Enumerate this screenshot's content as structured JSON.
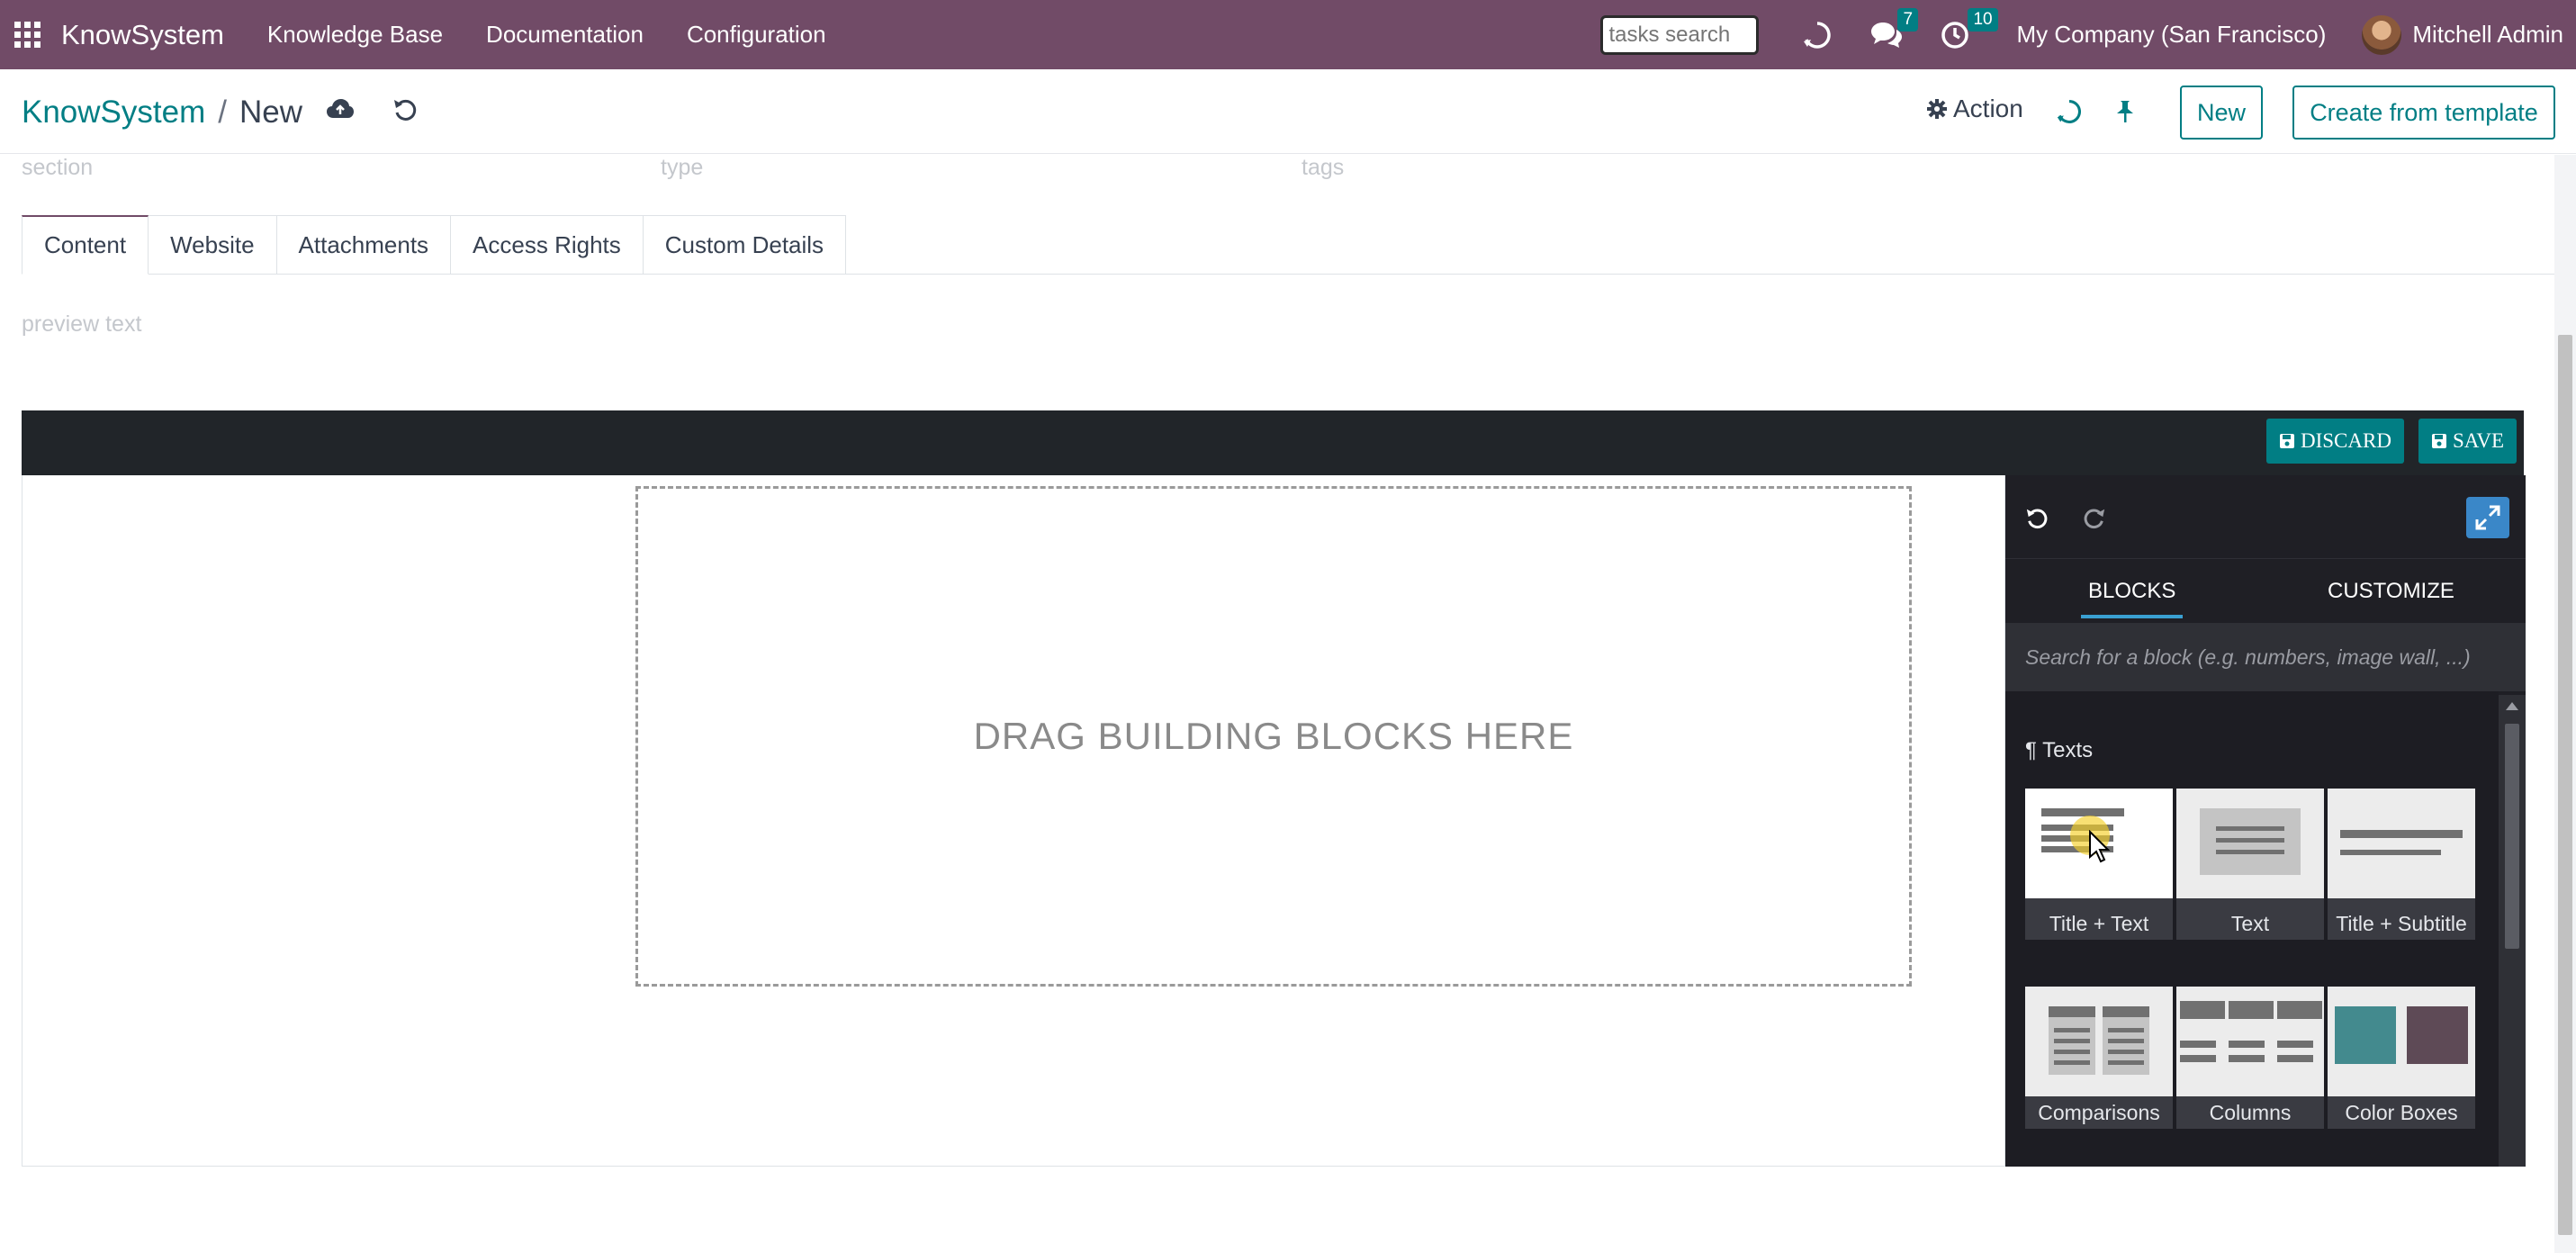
{
  "navbar": {
    "brand": "KnowSystem",
    "menu": [
      "Knowledge Base",
      "Documentation",
      "Configuration"
    ],
    "search_placeholder": "tasks search",
    "messages_count": "7",
    "activities_count": "10",
    "company": "My Company (San Francisco)",
    "user": "Mitchell Admin",
    "bar_color": "#714B67"
  },
  "control_panel": {
    "breadcrumb_root": "KnowSystem",
    "breadcrumb_current": "New",
    "action_label": "Action",
    "new_label": "New",
    "create_template_label": "Create from template"
  },
  "form": {
    "section_placeholder": "section",
    "type_placeholder": "type",
    "tags_placeholder": "tags",
    "tabs": [
      "Content",
      "Website",
      "Attachments",
      "Access Rights",
      "Custom Details"
    ],
    "active_tab": "Content",
    "preview_placeholder": "preview text"
  },
  "editor": {
    "discard_label": "DISCARD",
    "save_label": "SAVE",
    "dropzone_text": "DRAG BUILDING BLOCKS HERE",
    "accent_color": "#017e84"
  },
  "snippets_panel": {
    "tabs": [
      "BLOCKS",
      "CUSTOMIZE"
    ],
    "active_tab": "BLOCKS",
    "search_placeholder": "Search for a block (e.g. numbers, image wall, ...)",
    "section_icon": "¶",
    "section_title": "Texts",
    "blocks": [
      {
        "label": "Title + Text",
        "icon": "title-text-icon"
      },
      {
        "label": "Text",
        "icon": "text-icon"
      },
      {
        "label": "Title + Subtitle",
        "icon": "title-subtitle-icon"
      },
      {
        "label": "Comparisons",
        "icon": "comparisons-icon"
      },
      {
        "label": "Columns",
        "icon": "columns-icon"
      },
      {
        "label": "Color Boxes",
        "icon": "color-boxes-icon"
      }
    ]
  }
}
